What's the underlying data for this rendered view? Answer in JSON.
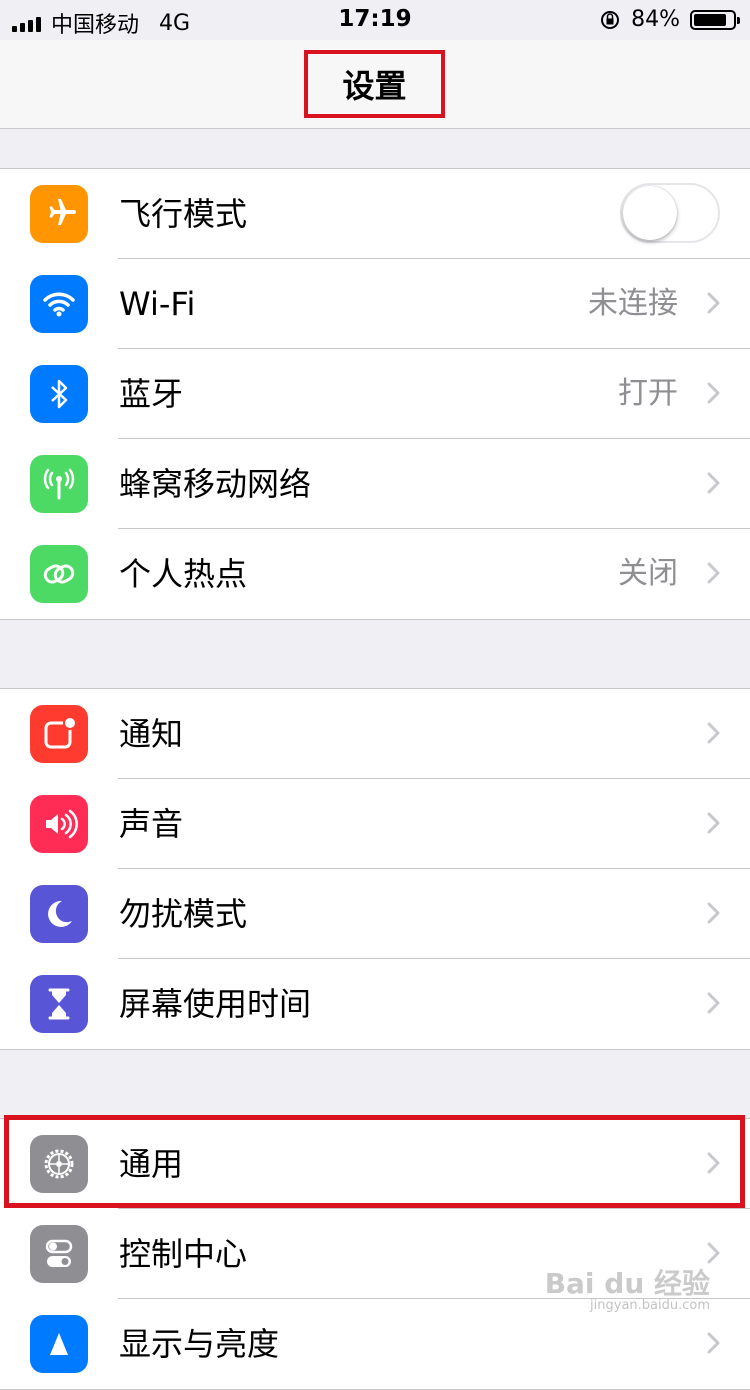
{
  "status_bar": {
    "carrier": "中国移动",
    "network": "4G",
    "time": "17:19",
    "battery_percent_text": "84%",
    "battery_level": 0.84
  },
  "nav": {
    "title": "设置"
  },
  "group1": [
    {
      "label": "飞行模式",
      "icon": "airplane-icon",
      "color": "#ff9500",
      "type": "toggle",
      "value": false
    },
    {
      "label": "Wi-Fi",
      "icon": "wifi-icon",
      "color": "#007aff",
      "detail": "未连接"
    },
    {
      "label": "蓝牙",
      "icon": "bluetooth-icon",
      "color": "#007aff",
      "detail": "打开"
    },
    {
      "label": "蜂窝移动网络",
      "icon": "antenna-icon",
      "color": "#4cd964",
      "detail": ""
    },
    {
      "label": "个人热点",
      "icon": "hotspot-icon",
      "color": "#4cd964",
      "detail": "关闭"
    }
  ],
  "group2": [
    {
      "label": "通知",
      "icon": "notification-icon",
      "color": "#ff3b30"
    },
    {
      "label": "声音",
      "icon": "speaker-icon",
      "color": "#ff2d55"
    },
    {
      "label": "勿扰模式",
      "icon": "moon-icon",
      "color": "#5856d6"
    },
    {
      "label": "屏幕使用时间",
      "icon": "hourglass-icon",
      "color": "#5856d6"
    }
  ],
  "group3": [
    {
      "label": "通用",
      "icon": "gear-icon",
      "color": "#8e8e93"
    },
    {
      "label": "控制中心",
      "icon": "switches-icon",
      "color": "#8e8e93"
    },
    {
      "label": "显示与亮度",
      "icon": "brightness-icon",
      "color": "#007aff"
    }
  ],
  "watermark": {
    "brand": "Bai du 经验",
    "url": "jingyan.baidu.com"
  }
}
